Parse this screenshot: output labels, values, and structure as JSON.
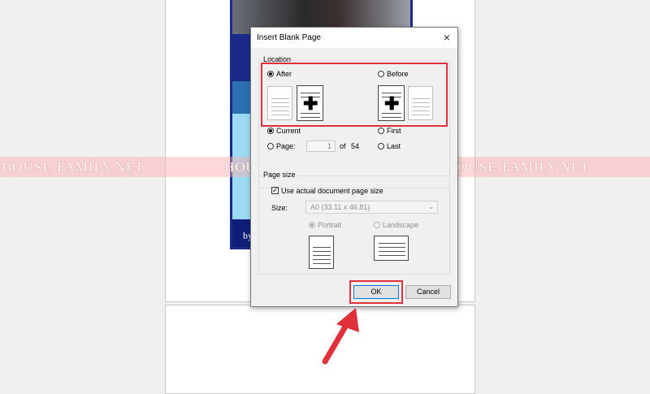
{
  "background": {
    "cover_text": "by",
    "watermark": [
      "HOUSE-FAMILY.NET",
      "HOUSE-FAMILY.NET",
      "HOUSE-FAMILY.NET"
    ]
  },
  "dialog": {
    "title": "Insert Blank Page",
    "close_icon": "×",
    "location": {
      "legend": "Location",
      "after_label": "After",
      "before_label": "Before",
      "current_label": "Current",
      "first_label": "First",
      "page_label": "Page:",
      "page_value": "1",
      "of_label": "of",
      "total_pages": "54",
      "last_label": "Last",
      "selected_position": "After",
      "selected_target": "Current"
    },
    "page_size": {
      "legend": "Page size",
      "use_actual_label": "Use actual document page size",
      "use_actual_checked": true,
      "size_label": "Size:",
      "size_value": "A0 (33.11 x 46.81)",
      "portrait_label": "Portrait",
      "landscape_label": "Landscape",
      "orientation_selected": "Portrait"
    },
    "ok_label": "OK",
    "cancel_label": "Cancel"
  },
  "colors": {
    "highlight": "#e0303a",
    "arrow": "#e0303a",
    "cover_blue": "#1b2a8a"
  },
  "icons": [
    "close-icon",
    "blank-page-icon",
    "plus-icon",
    "portrait-page-icon",
    "landscape-page-icon",
    "dropdown-arrow-icon",
    "checkmark-icon",
    "red-arrow-icon"
  ]
}
